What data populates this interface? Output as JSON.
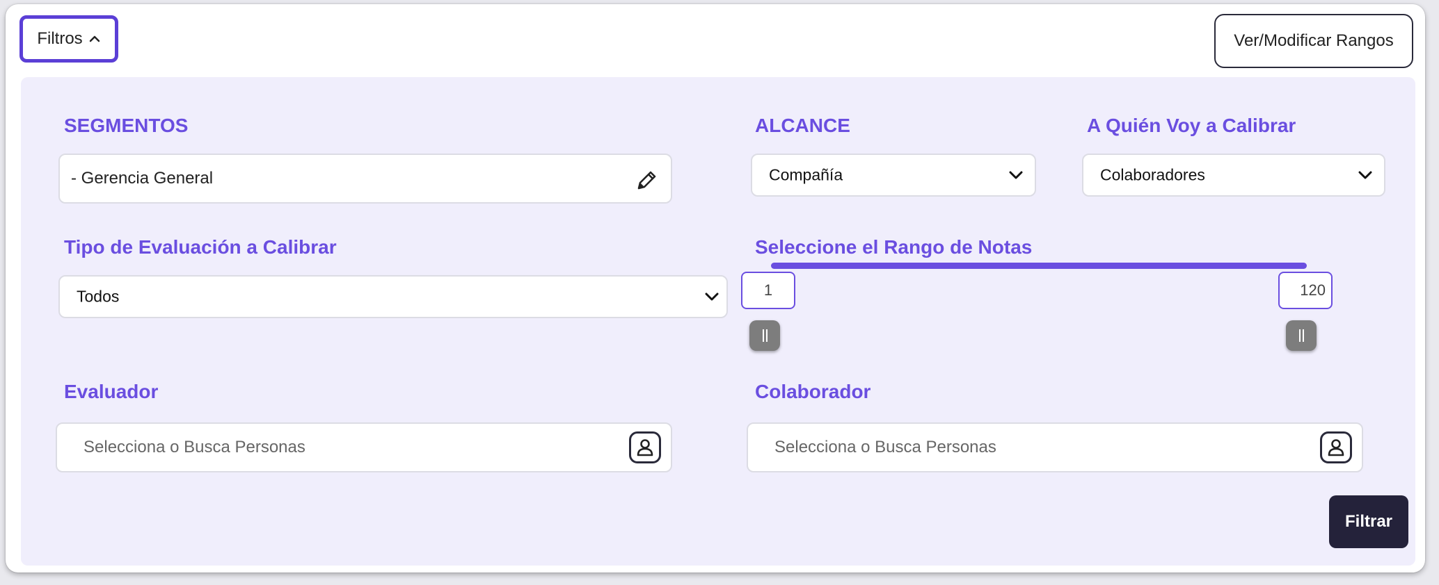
{
  "header": {
    "filters_label": "Filtros",
    "ranges_button": "Ver/Modificar Rangos"
  },
  "segmentos": {
    "label": "SEGMENTOS",
    "value": "- Gerencia General"
  },
  "alcance": {
    "label": "ALCANCE",
    "selected": "Compañía"
  },
  "a_quien": {
    "label": "A Quién Voy a Calibrar",
    "selected": "Colaboradores"
  },
  "tipo_evaluacion": {
    "label": "Tipo de Evaluación a Calibrar",
    "selected": "Todos"
  },
  "rango_notas": {
    "label": "Seleccione el Rango de Notas",
    "min_value": "1",
    "max_value": "120"
  },
  "evaluador": {
    "label": "Evaluador",
    "placeholder": "Selecciona o Busca Personas"
  },
  "colaborador": {
    "label": "Colaborador",
    "placeholder": "Selecciona o Busca Personas"
  },
  "actions": {
    "filter_button": "Filtrar"
  },
  "colors": {
    "accent": "#6a4ee0",
    "panel_bg": "#f0eefc",
    "dark_button": "#24223a"
  }
}
